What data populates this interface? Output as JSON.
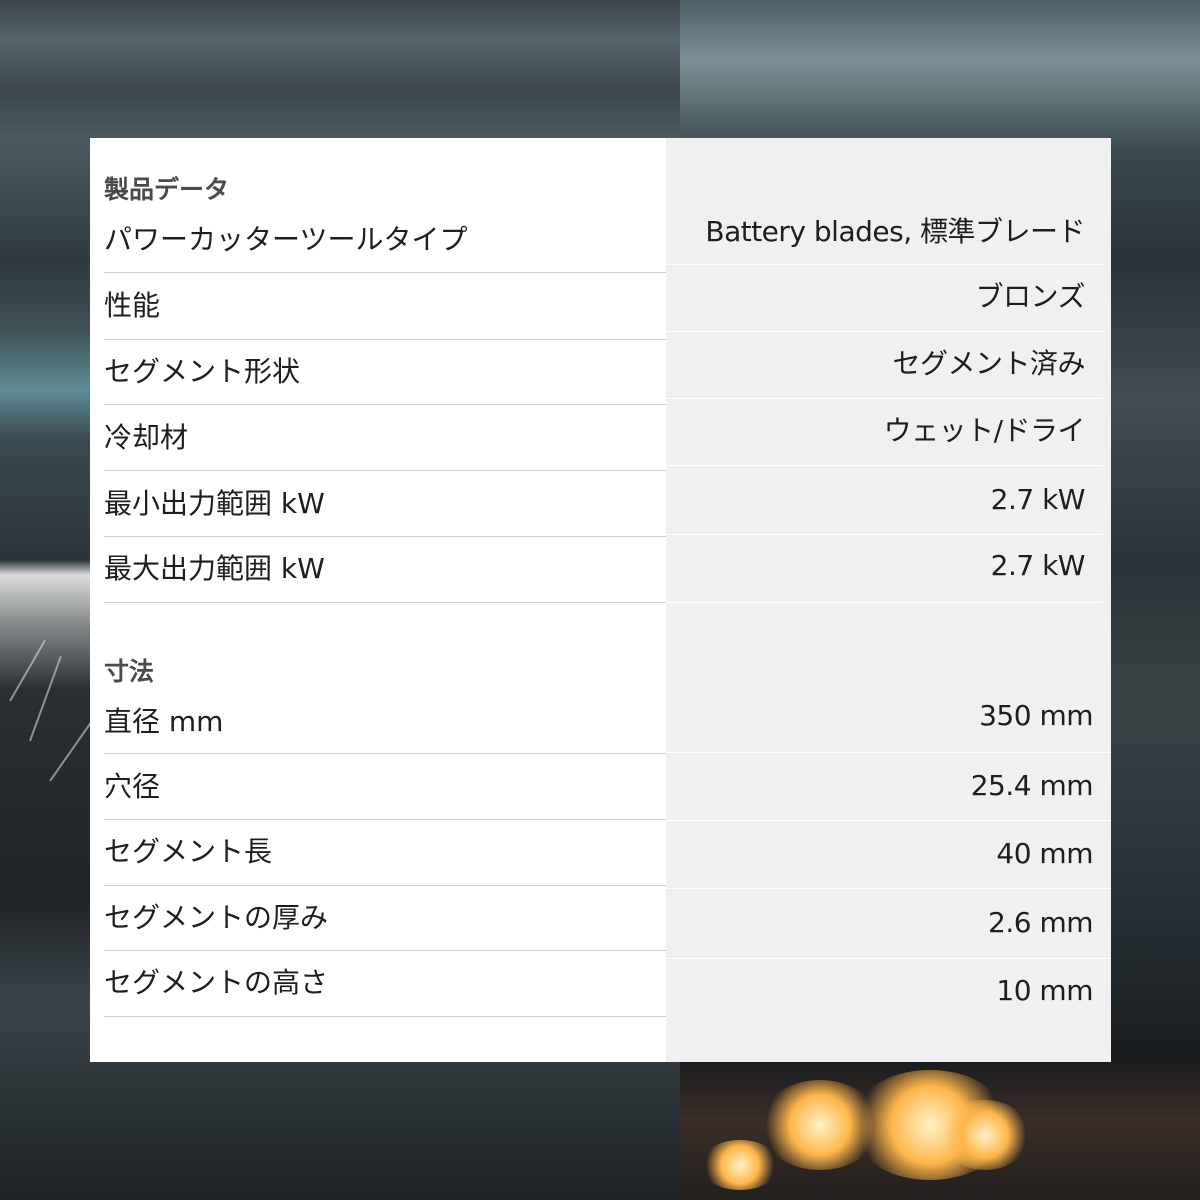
{
  "sections": {
    "product_data": "製品データ",
    "dimensions": "寸法"
  },
  "product_rows": [
    {
      "label": "パワーカッターツールタイプ",
      "value": "Battery blades, 標準ブレード"
    },
    {
      "label": "性能",
      "value": "ブロンズ"
    },
    {
      "label": "セグメント形状",
      "value": "セグメント済み"
    },
    {
      "label": "冷却材",
      "value": "ウェット/ドライ"
    },
    {
      "label": "最小出力範囲 kW",
      "value": "2.7 kW"
    },
    {
      "label": "最大出力範囲 kW",
      "value": "2.7 kW"
    }
  ],
  "dimension_rows": [
    {
      "label": "直径 mm",
      "value": "350 mm"
    },
    {
      "label": "穴径",
      "value": "25.4 mm"
    },
    {
      "label": "セグメント長",
      "value": "40 mm"
    },
    {
      "label": "セグメントの厚み",
      "value": "2.6 mm"
    },
    {
      "label": "セグメントの高さ",
      "value": "10 mm"
    }
  ]
}
